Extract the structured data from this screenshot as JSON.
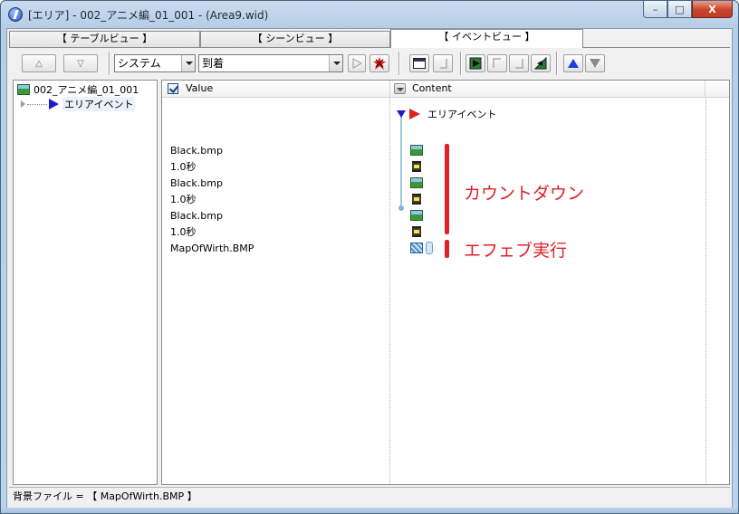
{
  "window": {
    "title": "[エリア] - 002_アニメ編_01_001 - (Area9.wid)",
    "controls": {
      "minimize": "–",
      "maximize": "□",
      "close": "X"
    }
  },
  "tabs": [
    {
      "label": "【 テーブルビュー 】",
      "active": false
    },
    {
      "label": "【 シーンビュー 】",
      "active": false
    },
    {
      "label": "【 イベントビュー 】",
      "active": true
    }
  ],
  "toolbar": {
    "up_label": "△",
    "down_label": "▽",
    "category_select": "システム",
    "event_select": "到着"
  },
  "tree": {
    "root": "002_アニメ編_01_001",
    "child": "エリアイベント"
  },
  "grid": {
    "col_value": "Value",
    "col_content": "Content",
    "event_name": "エリアイベント",
    "rows": [
      {
        "value": "Black.bmp",
        "icon": "image-icon"
      },
      {
        "value": "1.0秒",
        "icon": "hourglass-icon"
      },
      {
        "value": "Black.bmp",
        "icon": "image-icon"
      },
      {
        "value": "1.0秒",
        "icon": "hourglass-icon"
      },
      {
        "value": "Black.bmp",
        "icon": "image-icon"
      },
      {
        "value": "1.0秒",
        "icon": "hourglass-icon"
      },
      {
        "value": "MapOfWirth.BMP",
        "icon": "effect-icon"
      }
    ]
  },
  "annotations": {
    "countdown": "カウントダウン",
    "effect": "エフェブ実行"
  },
  "status": {
    "text": "背景ファイル = 【 MapOfWirth.BMP 】"
  },
  "colors": {
    "annotation_red": "#e0202a",
    "timeline_blue": "#9fc7e3",
    "event_arrow_blue": "#1b1bd0"
  }
}
